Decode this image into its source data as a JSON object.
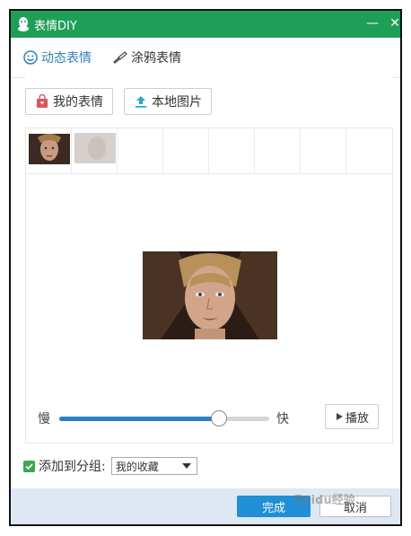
{
  "window": {
    "title": "表情DIY",
    "minimize_symbol": "—",
    "close_symbol": "✕"
  },
  "tabs": [
    {
      "label": "动态表情",
      "active": true
    },
    {
      "label": "涂鸦表情",
      "active": false
    }
  ],
  "buttons": {
    "my_emoji": "我的表情",
    "local_image": "本地图片",
    "play": "播放",
    "done": "完成",
    "cancel": "取消"
  },
  "speed": {
    "slow_label": "慢",
    "fast_label": "快",
    "value_fraction": 0.76
  },
  "group": {
    "label": "添加到分组:",
    "checked": true,
    "selected": "我的收藏"
  },
  "watermark": "Baidu经验",
  "colors": {
    "titlebar": "#1e9e57",
    "accent_blue": "#2d83c3",
    "done_button": "#1f90d8",
    "slider_fill": "#2b7fc6",
    "checkbox": "#3aa94b"
  }
}
